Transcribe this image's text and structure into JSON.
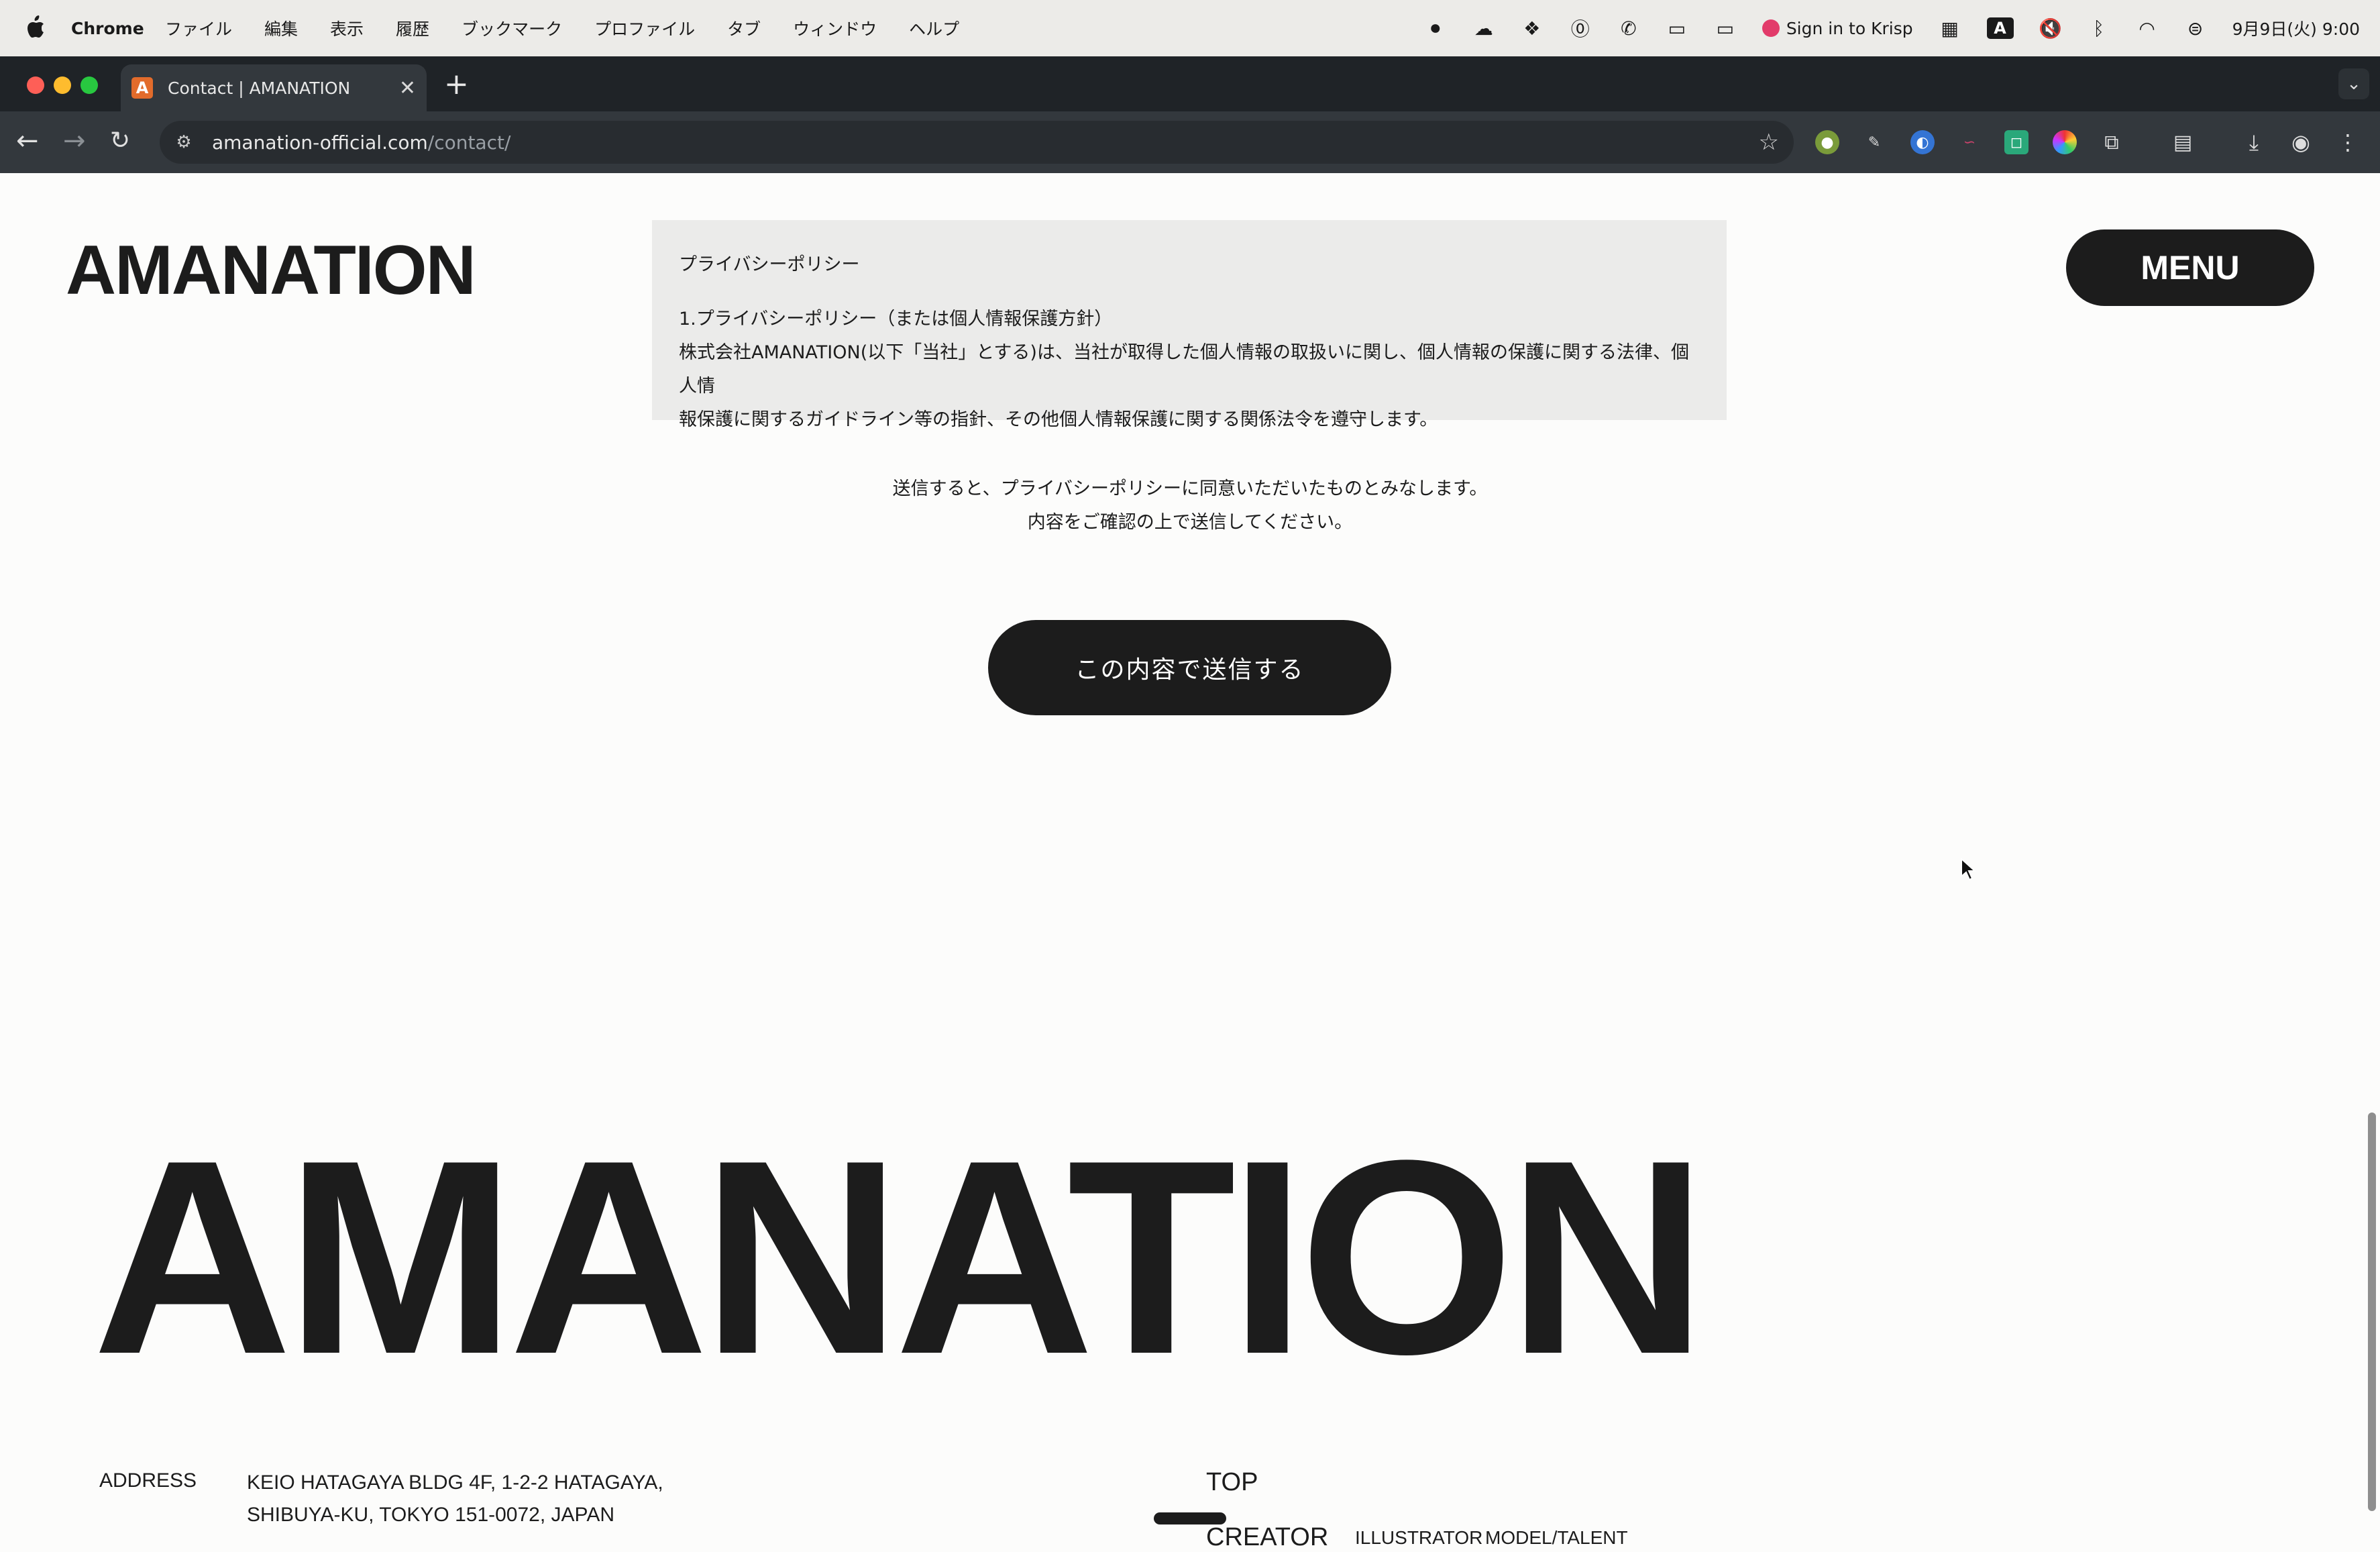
{
  "os_menubar": {
    "app_name": "Chrome",
    "menus": [
      "ファイル",
      "編集",
      "表示",
      "履歴",
      "ブックマーク",
      "プロファイル",
      "タブ",
      "ウィンドウ",
      "ヘルプ"
    ],
    "krisp_label": "Sign in to Krisp",
    "input_badge": "A",
    "datetime": "9月9日(火) 9:00"
  },
  "browser": {
    "tab_title": "Contact | AMANATION",
    "favicon_letter": "A",
    "url_host": "amanation-official.com",
    "url_path": "/contact/"
  },
  "site": {
    "logo": "AMANATION",
    "menu_label": "MENU"
  },
  "policy": {
    "heading": "プライバシーポリシー",
    "item_title": "1.プライバシーポリシー（または個人情報保護方針）",
    "body_line1": "株式会社AMANATION(以下「当社」とする)は、当社が取得した個人情報の取扱いに関し、個人情報の保護に関する法律、個人情",
    "body_line2": "報保護に関するガイドライン等の指針、その他個人情報保護に関する関係法令を遵守します。"
  },
  "consent": {
    "line1": "送信すると、プライバシーポリシーに同意いただいたものとみなします。",
    "line2": "内容をご確認の上で送信してください。"
  },
  "submit_label": "この内容で送信する",
  "footer": {
    "logo": "AMANATION",
    "address_label": "ADDRESS",
    "address_line1": "KEIO HATAGAYA BLDG 4F, 1-2-2 HATAGAYA,",
    "address_line2": "SHIBUYA-KU, TOKYO 151-0072, JAPAN",
    "nav_top": "TOP",
    "nav_creator": "CREATOR",
    "nav_illustrator": "ILLUSTRATOR",
    "nav_model": "MODEL/TALENT"
  }
}
